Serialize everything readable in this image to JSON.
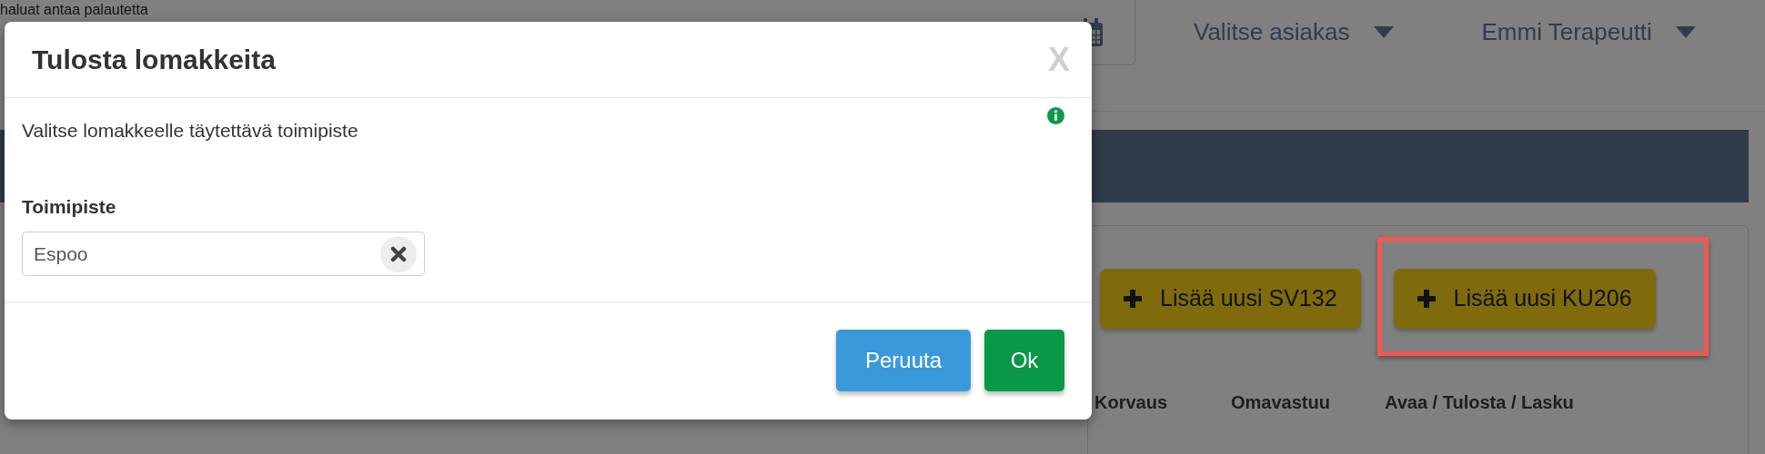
{
  "background": {
    "notice": "haluat antaa palautetta",
    "nav": [
      {
        "label": "Valitse asiakas"
      },
      {
        "label": "Emmi Terapeutti"
      }
    ],
    "actions": [
      {
        "label": "Lisää uusi SV132",
        "highlighted": false
      },
      {
        "label": "Lisää uusi KU206",
        "highlighted": true
      }
    ],
    "columns": [
      "Korvaus",
      "Omavastuu",
      "Avaa / Tulosta / Lasku"
    ]
  },
  "modal": {
    "title": "Tulosta lomakkeita",
    "close": "X",
    "message": "Valitse lomakkeelle täytettävä toimipiste",
    "field": {
      "label": "Toimipiste",
      "value": "Espoo"
    },
    "buttons": [
      {
        "label": "Peruuta",
        "kind": "secondary"
      },
      {
        "label": "Ok",
        "kind": "primary"
      }
    ]
  }
}
